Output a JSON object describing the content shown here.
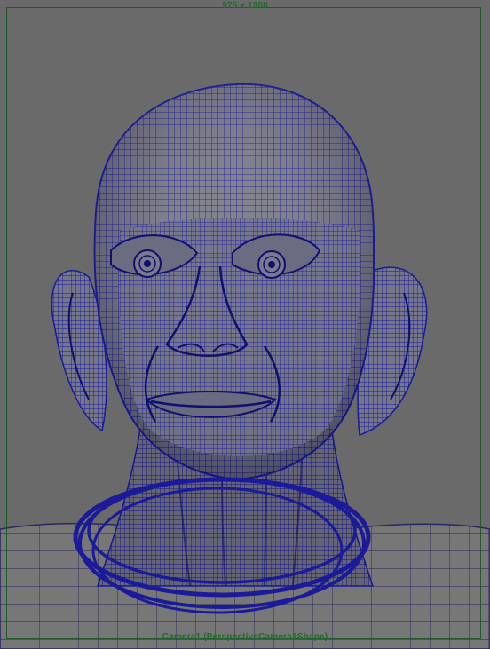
{
  "viewport": {
    "resolution_gate_label": "975 x 1300",
    "camera_label": "Camera1 (PerspectiveCamera1Shape)"
  },
  "colors": {
    "background": "#6a6a6a",
    "mesh_fill": "#7c7c8a",
    "wire_head": "#1a1a9a",
    "wire_body": "#2a2a6a",
    "hud_text": "#1f6a2a"
  },
  "icons": {
    "head": "wireframe-head-mesh",
    "body": "wireframe-body-mesh",
    "necklace": "wireframe-necklace-rings"
  }
}
